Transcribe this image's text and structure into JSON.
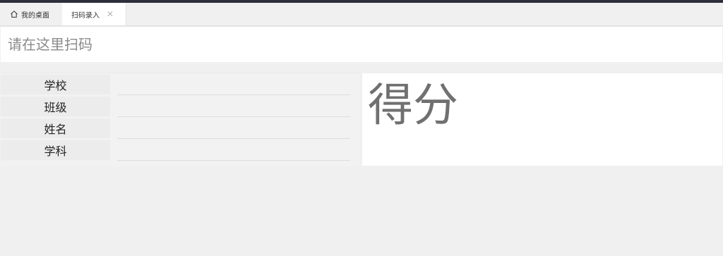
{
  "tabs": {
    "home_label": "我的桌面",
    "scan_label": "扫码录入",
    "close_glyph": "✕"
  },
  "scan": {
    "placeholder": "请在这里扫码",
    "value": ""
  },
  "info": {
    "rows": [
      {
        "label": "学校",
        "value": ""
      },
      {
        "label": "班级",
        "value": ""
      },
      {
        "label": "姓名",
        "value": ""
      },
      {
        "label": "学科",
        "value": ""
      }
    ]
  },
  "score": {
    "label": "得分"
  },
  "icons": {
    "home": "home-icon",
    "close": "close-icon"
  },
  "colors": {
    "topbar": "#2d2f3b",
    "background": "#f0f0f0",
    "score_text": "#707070"
  }
}
